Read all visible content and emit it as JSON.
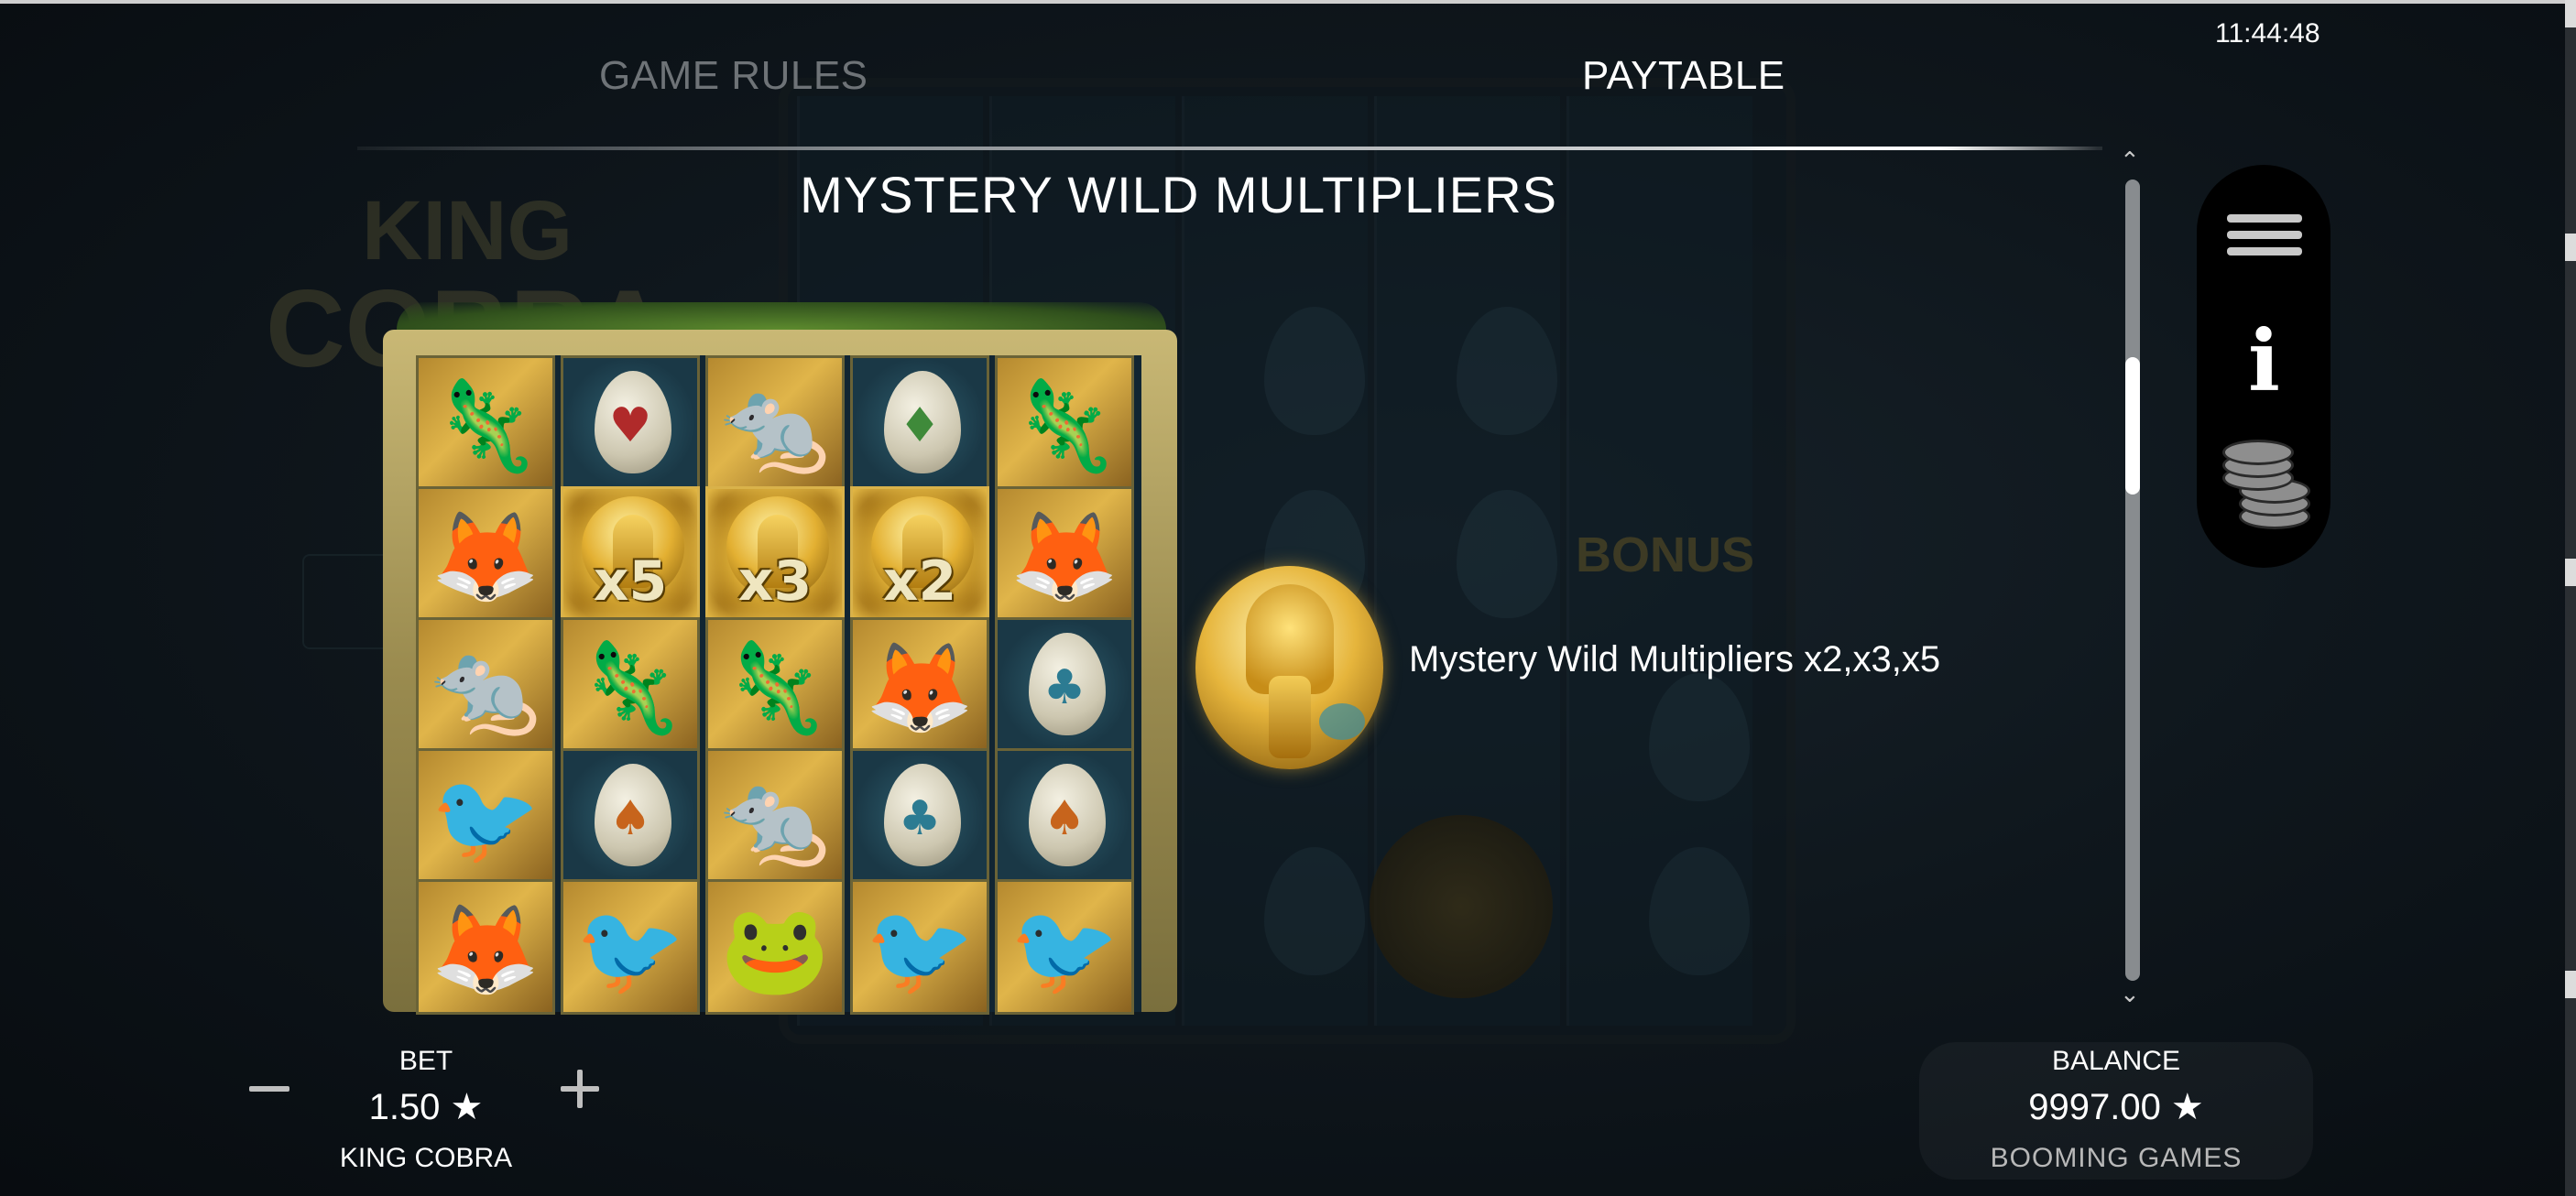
{
  "clock": "11:44:48",
  "tabs": [
    {
      "label": "GAME RULES",
      "active": false
    },
    {
      "label": "PAYTABLE",
      "active": true
    }
  ],
  "section": {
    "title": "MYSTERY WILD MULTIPLIERS",
    "symbol_icon": "golden-cobra-icon",
    "description": "Mystery Wild Multipliers x2,x3,x5"
  },
  "background": {
    "logo_text_line1": "KING",
    "logo_text_line2": "COBRA",
    "bonus_text": "BONUS"
  },
  "reels": {
    "columns": 5,
    "rows": 5,
    "cells": [
      [
        "lizard",
        "egg-heart",
        "rat",
        "egg-diamond",
        "lizard"
      ],
      [
        "weasel",
        "wild",
        "wild",
        "wild",
        "weasel"
      ],
      [
        "rat",
        "lizard",
        "lizard",
        "weasel",
        "egg-club"
      ],
      [
        "crow",
        "egg-spade",
        "rat",
        "egg-club",
        "egg-spade"
      ],
      [
        "weasel",
        "crow",
        "frog",
        "crow",
        "crow"
      ]
    ],
    "wild_multipliers": [
      "x5",
      "x3",
      "x2"
    ],
    "symbol_glyphs": {
      "lizard": "🦎",
      "rat": "🐀",
      "weasel": "🦊",
      "crow": "🐦",
      "frog": "🐸"
    },
    "suit_glyphs": {
      "heart": "♥",
      "diamond": "♦",
      "club": "♣",
      "spade": "♠"
    },
    "suit_colors": {
      "heart": "#b02a2a",
      "diamond": "#3f8a3a",
      "club": "#2c7b92",
      "spade": "#c7641c"
    }
  },
  "menu": {
    "items": [
      "menu-icon",
      "info-icon",
      "coins-icon"
    ]
  },
  "bottom": {
    "bet_label": "BET",
    "bet_value": "1.50 ★",
    "game_name": "KING COBRA",
    "minus_icon": "minus-icon",
    "plus_icon": "plus-icon",
    "balance_label": "BALANCE",
    "balance_value": "9997.00 ★",
    "brand": "BOOMING GAMES"
  },
  "colors": {
    "background": "#0b1015",
    "inactive_tab": "#6e7377",
    "active_text": "#ffffff",
    "gold": "#e6b53c"
  }
}
